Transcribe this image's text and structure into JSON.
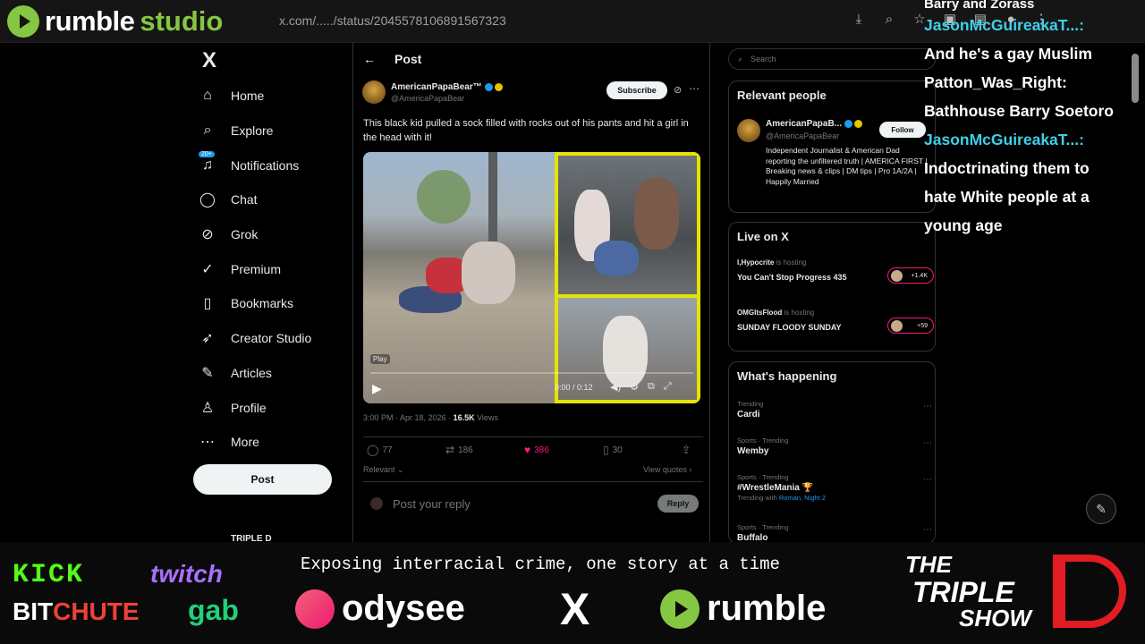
{
  "browser": {
    "brand": "rumble",
    "brand_suffix": "studio",
    "url": "x.com/...../status/2045578106891567323",
    "icons": [
      "download-icon",
      "zoom-icon",
      "star-icon",
      "extensions-icon",
      "sidebar-icon",
      "profile-icon",
      "menu-icon"
    ]
  },
  "x_nav": {
    "logo": "X",
    "items": [
      {
        "label": "Home",
        "icon": "home-icon"
      },
      {
        "label": "Explore",
        "icon": "search-icon"
      },
      {
        "label": "Notifications",
        "icon": "bell-icon",
        "badge": "20+"
      },
      {
        "label": "Chat",
        "icon": "chat-icon"
      },
      {
        "label": "Grok",
        "icon": "grok-icon"
      },
      {
        "label": "Premium",
        "icon": "premium-icon"
      },
      {
        "label": "Bookmarks",
        "icon": "bookmark-icon"
      },
      {
        "label": "Creator Studio",
        "icon": "rocket-icon"
      },
      {
        "label": "Articles",
        "icon": "article-icon"
      },
      {
        "label": "Profile",
        "icon": "person-icon"
      },
      {
        "label": "More",
        "icon": "more-icon"
      }
    ],
    "post_button": "Post",
    "account": "TRIPLE D"
  },
  "post": {
    "header": "Post",
    "author_name": "AmericanPapaBear™",
    "author_handle": "@AmericaPapaBear",
    "subscribe": "Subscribe",
    "text": "This black kid pulled a sock filled with rocks out of his pants and hit a girl in the head with it!",
    "video": {
      "play_label": "Play",
      "time": "0:00 / 0:12",
      "progress": 0.0
    },
    "timestamp": "3:00 PM · Apr 18, 2026 · ",
    "views": "16.5K",
    "views_label": " Views",
    "actions": {
      "replies": "77",
      "reposts": "186",
      "likes": "386",
      "bookmarks": "30"
    },
    "relevant": "Relevant ⌄",
    "view_quotes": "View quotes ›",
    "reply_placeholder": "Post your reply",
    "reply_button": "Reply"
  },
  "sidebar": {
    "search_placeholder": "Search",
    "relevant_people": {
      "title": "Relevant people",
      "name": "AmericanPapaB...",
      "handle": "@AmericaPapaBear",
      "follow": "Follow",
      "bio": "Independent Journalist & American Dad reporting the unfiltered truth | AMERICA FIRST | Breaking news & clips | DM tips | Pro 1A/2A | Happily Married"
    },
    "live": {
      "title": "Live on X",
      "items": [
        {
          "host": "I,Hypocrite",
          "status": " is hosting",
          "title": "You Can't Stop Progress 435",
          "count": "+1.4K"
        },
        {
          "host": "OMGItsFlood",
          "status": " is hosting",
          "title": "SUNDAY FLOODY SUNDAY",
          "count": "+59"
        }
      ]
    },
    "happening": {
      "title": "What's happening",
      "items": [
        {
          "category": "Trending",
          "name": "Cardi",
          "with": ""
        },
        {
          "category": "Sports · Trending",
          "name": "Wemby",
          "with": ""
        },
        {
          "category": "Sports · Trending",
          "name": "#WrestleMania 🏆",
          "with": "Roman, Night 2"
        },
        {
          "category": "Sports · Trending",
          "name": "Buffalo",
          "with": ""
        }
      ]
    }
  },
  "chat": {
    "lines": [
      {
        "user": "",
        "text": "Barry and Zorass"
      },
      {
        "user": "JasonMcGuireakaT...:",
        "text": ""
      },
      {
        "user": "",
        "text": "And he's a gay Muslim"
      },
      {
        "user": "",
        "text": "Patton_Was_Right:"
      },
      {
        "user": "",
        "text": "Bathhouse Barry Soetoro"
      },
      {
        "user": "JasonMcGuireakaT...:",
        "text": ""
      },
      {
        "user": "",
        "text": "Indoctrinating them to"
      },
      {
        "user": "",
        "text": "hate White people at a"
      },
      {
        "user": "",
        "text": "young age"
      }
    ]
  },
  "banner": {
    "kick": "KICK",
    "twitch": "twitch",
    "bitchute_bit": "BIT",
    "bitchute_chute": "CHUTE",
    "gab": "gab",
    "tagline": "Exposing interracial crime, one story at a time",
    "odysee": "odysee",
    "x": "X",
    "rumble": "rumble",
    "show_line1": "THE",
    "show_line2": "TRIPLE",
    "show_line3": "SHOW"
  }
}
